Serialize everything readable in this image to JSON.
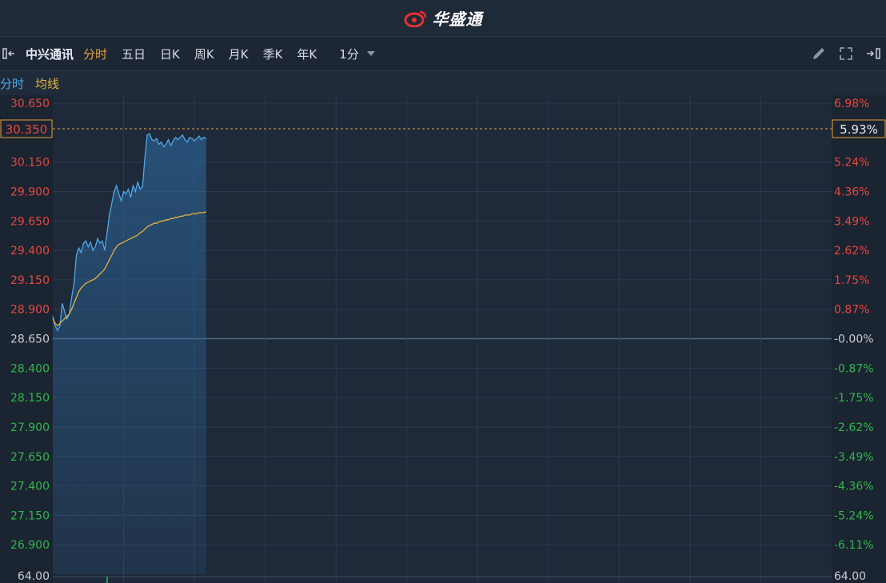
{
  "brand": {
    "name": "华盛通",
    "accent": "#e8302e"
  },
  "toolbar": {
    "stock_name": "中兴通讯",
    "periods": [
      "分时",
      "五日",
      "日K",
      "周K",
      "月K",
      "季K",
      "年K"
    ],
    "active_period": "分时",
    "interval_label": "1分",
    "icons": [
      "collapse-left-icon",
      "pencil-icon",
      "fullscreen-icon",
      "collapse-right-icon"
    ]
  },
  "legend": {
    "price_label": "分时",
    "avg_label": "均线",
    "price_color": "#4fa8e8",
    "avg_color": "#e8b23a"
  },
  "chart_data": {
    "type": "line",
    "prev_close": 28.65,
    "ylim": [
      26.65,
      30.65
    ],
    "current_price_label": "30.350",
    "current_pct_label": "5.93%",
    "y_ticks": [
      "30.650",
      "30.150",
      "29.900",
      "29.650",
      "29.400",
      "29.150",
      "28.900",
      "28.650",
      "28.400",
      "28.150",
      "27.900",
      "27.650",
      "27.400",
      "27.150",
      "26.900"
    ],
    "y_tick_values": [
      30.65,
      30.15,
      29.9,
      29.65,
      29.4,
      29.15,
      28.9,
      28.65,
      28.4,
      28.15,
      27.9,
      27.65,
      27.4,
      27.15,
      26.9
    ],
    "pct_ticks": [
      "6.98%",
      "5.24%",
      "4.36%",
      "3.49%",
      "2.62%",
      "1.75%",
      "0.87%",
      "-0.00%",
      "-0.87%",
      "-1.75%",
      "-2.62%",
      "-3.49%",
      "-4.36%",
      "-5.24%",
      "-6.11%"
    ],
    "volume_label_left": "64.00",
    "volume_label_right": "64.00",
    "minutes_total": 330,
    "series": [
      {
        "name": "分时",
        "color": "#4fa8e8",
        "x": [
          0,
          1,
          2,
          3,
          4,
          5,
          6,
          7,
          8,
          9,
          10,
          11,
          12,
          13,
          14,
          15,
          16,
          17,
          18,
          19,
          20,
          21,
          22,
          23,
          24,
          25,
          26,
          27,
          28,
          29,
          30,
          31,
          32,
          33,
          34,
          35,
          36,
          37,
          38,
          39,
          40,
          41,
          42,
          43,
          44,
          45,
          46,
          47,
          48,
          49,
          50,
          51,
          52,
          53,
          54,
          55,
          56,
          57,
          58,
          59,
          60,
          61,
          62,
          63,
          64,
          65
        ],
        "values": [
          28.84,
          28.76,
          28.72,
          28.76,
          28.95,
          28.88,
          28.82,
          28.86,
          29.0,
          29.12,
          29.36,
          29.42,
          29.38,
          29.46,
          29.48,
          29.43,
          29.47,
          29.4,
          29.43,
          29.5,
          29.46,
          29.48,
          29.4,
          29.55,
          29.7,
          29.8,
          29.9,
          29.95,
          29.88,
          29.82,
          29.9,
          29.88,
          29.92,
          29.85,
          29.95,
          29.9,
          29.98,
          29.92,
          29.94,
          30.18,
          30.38,
          30.39,
          30.34,
          30.33,
          30.35,
          30.3,
          30.32,
          30.28,
          30.3,
          30.34,
          30.29,
          30.33,
          30.36,
          30.34,
          30.36,
          30.38,
          30.34,
          30.32,
          30.36,
          30.35,
          30.33,
          30.35,
          30.37,
          30.34,
          30.36,
          30.35
        ]
      },
      {
        "name": "均线",
        "color": "#e8b23a",
        "x": [
          0,
          1,
          2,
          3,
          4,
          5,
          6,
          7,
          8,
          9,
          10,
          11,
          12,
          13,
          14,
          15,
          16,
          17,
          18,
          19,
          20,
          21,
          22,
          23,
          24,
          25,
          26,
          27,
          28,
          29,
          30,
          31,
          32,
          33,
          34,
          35,
          36,
          37,
          38,
          39,
          40,
          41,
          42,
          43,
          44,
          45,
          46,
          47,
          48,
          49,
          50,
          51,
          52,
          53,
          54,
          55,
          56,
          57,
          58,
          59,
          60,
          61,
          62,
          63,
          64,
          65
        ],
        "values": [
          28.82,
          28.78,
          28.76,
          28.78,
          28.8,
          28.82,
          28.84,
          28.86,
          28.9,
          28.95,
          29.0,
          29.05,
          29.08,
          29.1,
          29.12,
          29.13,
          29.14,
          29.15,
          29.16,
          29.18,
          29.2,
          29.22,
          29.24,
          29.28,
          29.32,
          29.36,
          29.4,
          29.43,
          29.45,
          29.46,
          29.47,
          29.48,
          29.49,
          29.5,
          29.51,
          29.52,
          29.53,
          29.55,
          29.56,
          29.58,
          29.6,
          29.61,
          29.62,
          29.63,
          29.63,
          29.64,
          29.65,
          29.65,
          29.66,
          29.66,
          29.67,
          29.67,
          29.68,
          29.68,
          29.69,
          29.69,
          29.7,
          29.7,
          29.7,
          29.71,
          29.71,
          29.71,
          29.72,
          29.72,
          29.72,
          29.73
        ]
      }
    ]
  }
}
